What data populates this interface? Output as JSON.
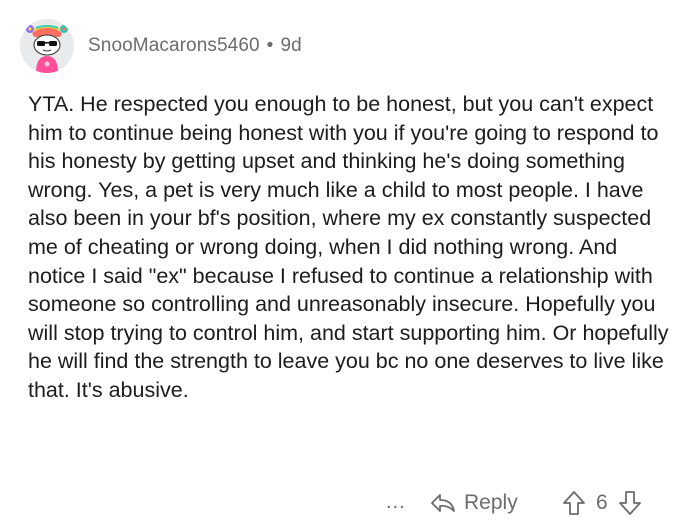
{
  "comment": {
    "username": "SnooMacarons5460",
    "separator": "•",
    "age": "9d",
    "avatar_icon": "snoo-avatar-icon",
    "body": "YTA. He respected you enough to be honest, but you can't expect him to continue being honest with you if you're going to respond to his honesty by getting upset and thinking he's doing something wrong. Yes, a pet is very much like a child to most people. I have also been in your bf's position, where my ex constantly suspected me of cheating or wrong doing, when I did nothing wrong. And notice I said \"ex\" because I refused to continue a relationship with someone so controlling and unreasonably insecure. Hopefully you will stop trying to control him, and start supporting him. Or hopefully he will find the strength to leave you bc no one deserves to live like that. It's abusive."
  },
  "actions": {
    "more_label": "...",
    "reply_label": "Reply",
    "reply_icon": "reply-arrow-icon",
    "upvote_icon": "upvote-arrow-icon",
    "downvote_icon": "downvote-arrow-icon",
    "vote_count": "6"
  },
  "colors": {
    "text": "#1c1c1c",
    "muted": "#6a6c6e",
    "background": "#ffffff"
  }
}
